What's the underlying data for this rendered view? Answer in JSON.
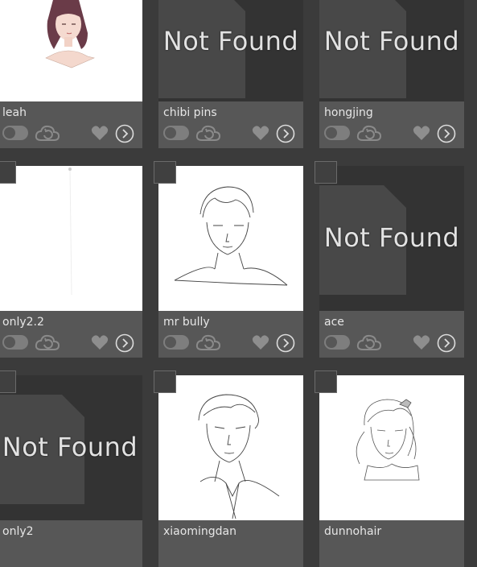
{
  "not_found_label": "Not Found",
  "cards": [
    {
      "title": "leah",
      "image": "portrait"
    },
    {
      "title": "chibi pins",
      "image": "not-found"
    },
    {
      "title": "hongjing",
      "image": "not-found"
    },
    {
      "title": "only2.2",
      "image": "blank"
    },
    {
      "title": "mr bully",
      "image": "sketch"
    },
    {
      "title": "ace",
      "image": "not-found"
    },
    {
      "title": "only2",
      "image": "not-found"
    },
    {
      "title": "xiaomingdan",
      "image": "sketch"
    },
    {
      "title": "dunnohair",
      "image": "sketch"
    }
  ],
  "colors": {
    "background": "#3b3b3b",
    "meta_bar": "#575757",
    "placeholder": "#333333"
  },
  "icons": [
    "toggle-icon",
    "cloud-sync-icon",
    "heart-icon",
    "chevron-right-circle-icon",
    "document-icon"
  ]
}
